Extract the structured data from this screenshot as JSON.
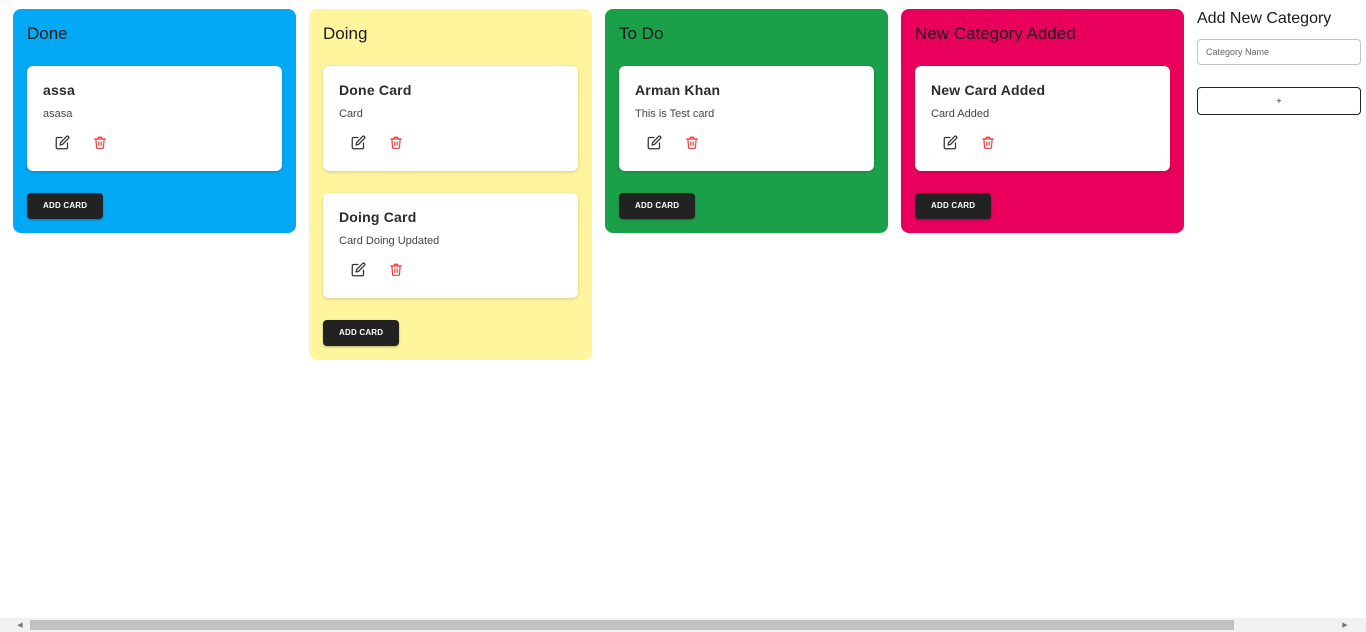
{
  "columns": [
    {
      "title": "Done",
      "color": "#03a9f4",
      "cards": [
        {
          "title": "assa",
          "description": "asasa"
        }
      ],
      "add_label": "ADD CARD"
    },
    {
      "title": "Doing",
      "color": "#fff59d",
      "cards": [
        {
          "title": "Done Card",
          "description": "Card"
        },
        {
          "title": "Doing Card",
          "description": "Card Doing Updated"
        }
      ],
      "add_label": "ADD CARD"
    },
    {
      "title": "To Do",
      "color": "#1ba04a",
      "cards": [
        {
          "title": "Arman Khan",
          "description": "This is Test card"
        }
      ],
      "add_label": "ADD CARD"
    },
    {
      "title": "New Category Added",
      "color": "#e8005c",
      "cards": [
        {
          "title": "New Card Added",
          "description": "Card Added"
        }
      ],
      "add_label": "ADD CARD"
    }
  ],
  "icons": {
    "edit": "edit-icon",
    "delete": "trash-icon",
    "submit": "plus-icon"
  },
  "colors": {
    "edit_icon": "#333333",
    "delete_icon": "#e53935"
  },
  "add_category": {
    "title": "Add New Category",
    "placeholder": "Category Name",
    "submit_label": "+"
  }
}
